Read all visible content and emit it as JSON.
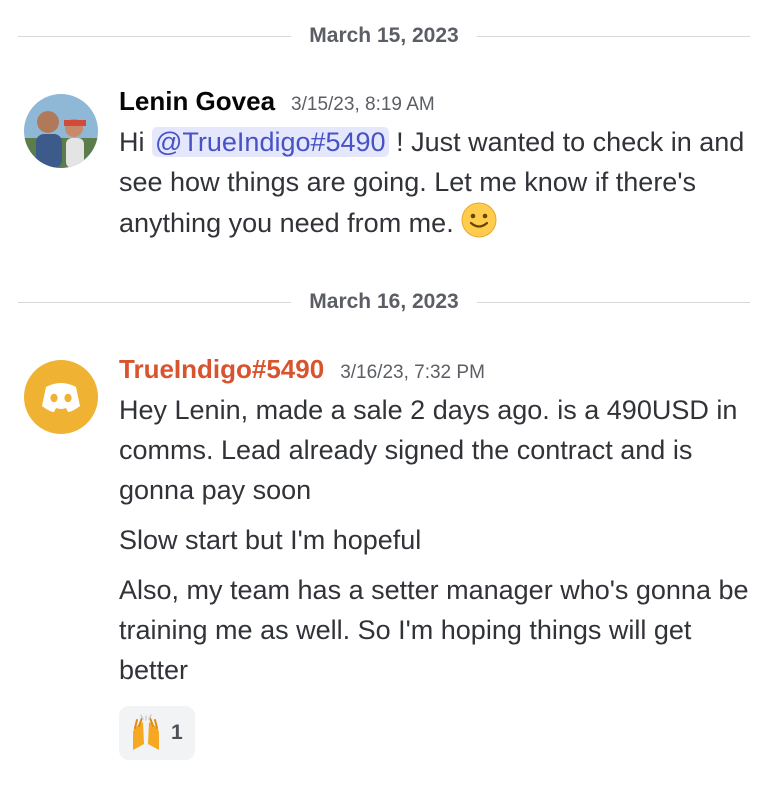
{
  "dividers": [
    {
      "date": "March 15, 2023"
    },
    {
      "date": "March 16, 2023"
    }
  ],
  "messages": [
    {
      "author": "Lenin Govea",
      "timestamp": "3/15/23, 8:19 AM",
      "text_before": "Hi ",
      "mention": "@TrueIndigo#5490",
      "text_after": " ! Just wanted to check in and see how things are going. Let me know if there's anything you need from me. "
    },
    {
      "author": "TrueIndigo#5490",
      "author_color": "#d9532e",
      "avatar_color": "#f0b232",
      "timestamp": "3/16/23, 7:32 PM",
      "lines": [
        "Hey Lenin, made a sale 2 days ago. is a 490USD in comms. Lead already signed the contract and is gonna pay soon",
        "Slow start but I'm hopeful",
        "Also, my team has a setter manager who's gonna be training me as well. So I'm hoping things will get better"
      ],
      "reaction": {
        "emoji": "raised-hands-icon",
        "count": "1"
      }
    }
  ]
}
